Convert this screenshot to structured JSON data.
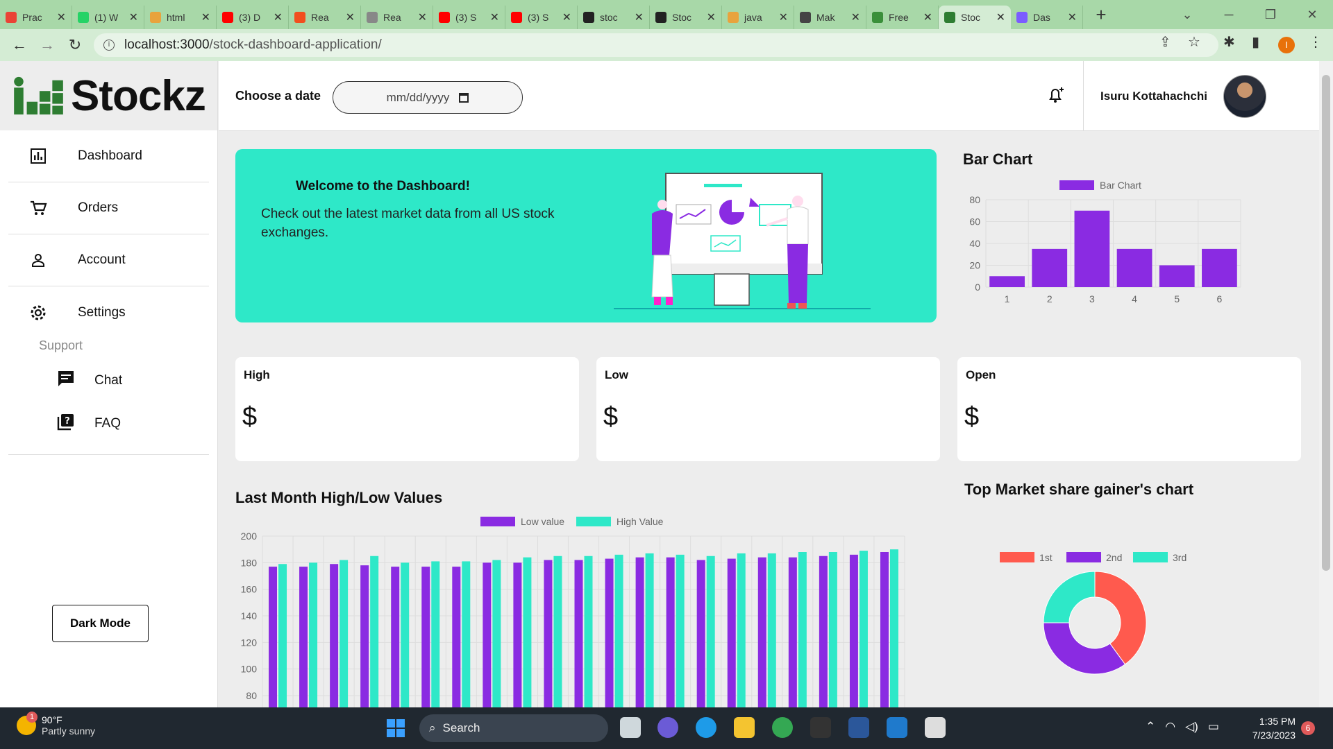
{
  "browser": {
    "tabs": [
      {
        "title": "Prac",
        "color": "#ea4335"
      },
      {
        "title": "(1) W",
        "color": "#25d366"
      },
      {
        "title": "html",
        "color": "#e8a33d"
      },
      {
        "title": "(3) D",
        "color": "#ff0000"
      },
      {
        "title": "Rea",
        "color": "#f24e1e"
      },
      {
        "title": "Rea",
        "color": "#888888"
      },
      {
        "title": "(3) S",
        "color": "#ff0000"
      },
      {
        "title": "(3) S",
        "color": "#ff0000"
      },
      {
        "title": "stoc",
        "color": "#222222"
      },
      {
        "title": "Stoc",
        "color": "#222222"
      },
      {
        "title": "java",
        "color": "#e8a33d"
      },
      {
        "title": "Mak",
        "color": "#444444"
      },
      {
        "title": "Free",
        "color": "#3a8f3a"
      },
      {
        "title": "Stoc",
        "color": "#2e7d32",
        "active": true
      },
      {
        "title": "Das",
        "color": "#7b5cff"
      }
    ],
    "url_host": "localhost:3000",
    "url_path": "/stock-dashboard-application/",
    "profile_initial": "I"
  },
  "sidebar": {
    "brand": "Stockz",
    "nav": [
      {
        "label": "Dashboard",
        "icon": "bar-chart-icon"
      },
      {
        "label": "Orders",
        "icon": "cart-icon"
      },
      {
        "label": "Account",
        "icon": "person-icon"
      },
      {
        "label": "Settings",
        "icon": "gear-icon"
      }
    ],
    "support_label": "Support",
    "support": [
      {
        "label": "Chat",
        "icon": "chat-icon"
      },
      {
        "label": "FAQ",
        "icon": "faq-icon"
      }
    ],
    "dark_mode_label": "Dark Mode"
  },
  "topbar": {
    "date_label": "Choose a date",
    "date_placeholder": "mm/dd/yyyy",
    "user_name": "Isuru Kottahachchi"
  },
  "welcome": {
    "title": "Welcome to the Dashboard!",
    "text": "Check out the latest market data from all US stock exchanges."
  },
  "cards": [
    {
      "label": "High",
      "value": "$"
    },
    {
      "label": "Low",
      "value": "$"
    },
    {
      "label": "Open",
      "value": "$"
    }
  ],
  "colors": {
    "purple": "#8a2be2",
    "teal": "#2ee8c8",
    "red": "#ff5a4e"
  },
  "chart_data": [
    {
      "type": "bar",
      "title": "Bar Chart",
      "series": [
        {
          "name": "Bar Chart",
          "values": [
            10,
            35,
            70,
            35,
            20,
            35
          ]
        }
      ],
      "categories": [
        "1",
        "2",
        "3",
        "4",
        "5",
        "6"
      ],
      "ylim": [
        0,
        80
      ],
      "yticks": [
        0,
        20,
        40,
        60,
        80
      ],
      "grid": true,
      "legend": "top"
    },
    {
      "type": "bar",
      "title": "Last Month High/Low Values",
      "series": [
        {
          "name": "Low value",
          "values": [
            177,
            177,
            179,
            178,
            177,
            177,
            177,
            180,
            180,
            182,
            182,
            183,
            184,
            184,
            182,
            183,
            184,
            184,
            185,
            186,
            188
          ]
        },
        {
          "name": "High Value",
          "values": [
            179,
            180,
            182,
            185,
            180,
            181,
            181,
            182,
            184,
            185,
            185,
            186,
            187,
            186,
            185,
            187,
            187,
            188,
            188,
            189,
            190
          ]
        }
      ],
      "ylim": [
        80,
        200
      ],
      "yticks": [
        80,
        100,
        120,
        140,
        160,
        180,
        200
      ],
      "grid": true,
      "legend": "top"
    },
    {
      "type": "pie",
      "title": "Top Market share gainer's chart",
      "categories": [
        "1st",
        "2nd",
        "3rd"
      ],
      "values": [
        40,
        35,
        25
      ],
      "legend": "top"
    }
  ],
  "taskbar": {
    "weather_temp": "90°F",
    "weather_desc": "Partly sunny",
    "weather_badge": "1",
    "search_label": "Search",
    "time": "1:35 PM",
    "date": "7/23/2023",
    "notifications": "6"
  }
}
